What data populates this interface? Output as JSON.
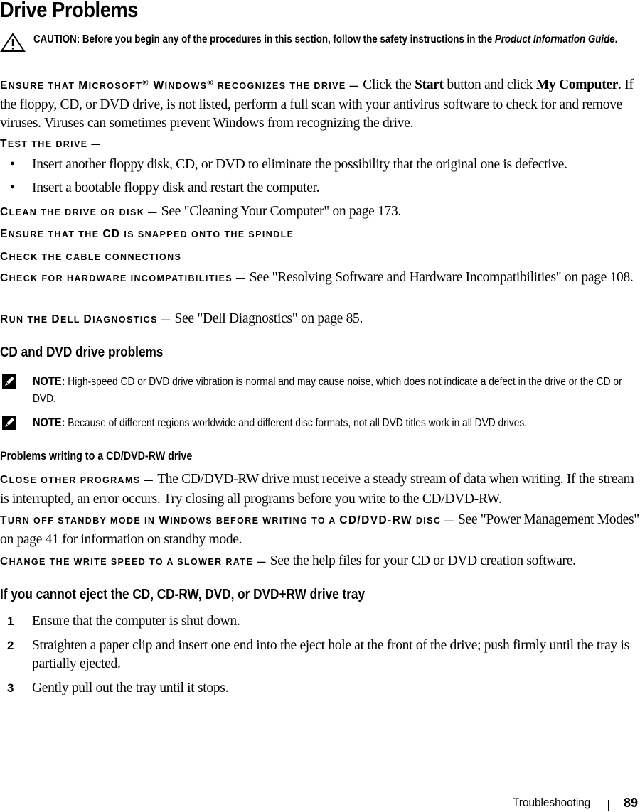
{
  "page_title": "Drive Problems",
  "caution": {
    "icon": "warning-triangle-icon",
    "label": "CAUTION:",
    "text_before": " Before you begin any of the procedures in this section, follow the safety instructions in the ",
    "guide_name": "Product Information Guide",
    "text_after": "."
  },
  "sections": {
    "ensure_windows": {
      "lead_parts": [
        "E",
        "nsure that ",
        "M",
        "icrosoft",
        "®",
        " W",
        "indows",
        "®",
        " recognizes the drive — "
      ],
      "text1": "Click the ",
      "bold1": "Start",
      "text2": " button and click ",
      "bold2": "My Computer",
      "text3": ". If the floppy, CD, or DVD drive, is not listed, perform a full scan with your antivirus software to check for and remove viruses. Viruses can sometimes prevent Windows from recognizing the drive."
    },
    "test_drive": {
      "lead": [
        "T",
        "est the drive —"
      ],
      "bullets": [
        "Insert another floppy disk, CD, or DVD to eliminate the possibility that the original one is defective.",
        "Insert a bootable floppy disk and restart the computer."
      ]
    },
    "clean_drive": {
      "lead": [
        "C",
        "lean the drive or disk — "
      ],
      "text": "See \"Cleaning Your Computer\" on page 173."
    },
    "ensure_cd": {
      "lead": [
        "E",
        "nsure that the ",
        "CD",
        " is snapped onto the spindle"
      ]
    },
    "check_cable": {
      "lead": [
        "C",
        "heck the cable connections"
      ]
    },
    "check_hardware": {
      "lead": [
        "C",
        "heck for hardware incompatibilities — "
      ],
      "text": "See \"Resolving Software and Hardware Incompatibilities\" on page 108."
    },
    "run_diagnostics": {
      "lead": [
        "R",
        "un the ",
        "D",
        "ell ",
        "D",
        "iagnostics — "
      ],
      "text": "See \"Dell Diagnostics\" on page 85."
    }
  },
  "cd_dvd": {
    "heading": "CD and DVD drive problems",
    "notes": [
      {
        "icon": "note-pencil-icon",
        "label": "NOTE:",
        "text": " High-speed CD or DVD drive vibration is normal and may cause noise, which does not indicate a defect in the drive or the CD or DVD."
      },
      {
        "icon": "note-pencil-icon",
        "label": "NOTE:",
        "text": " Because of different regions worldwide and different disc formats, not all DVD titles work in all DVD drives."
      }
    ]
  },
  "writing": {
    "heading": "Problems writing to a CD/DVD-RW drive",
    "close_programs": {
      "lead": [
        "C",
        "lose other programs — "
      ],
      "text": "The CD/DVD-RW drive must receive a steady stream of data when writing. If the stream is interrupted, an error occurs. Try closing all programs before you write to the CD/DVD-RW."
    },
    "standby": {
      "lead": [
        "T",
        "urn off standby mode in ",
        "W",
        "indows before writing to a ",
        "CD/DVD-RW",
        " disc — "
      ],
      "text": "See \"Power Management Modes\" on page 41 for information on standby mode."
    },
    "write_speed": {
      "lead": [
        "C",
        "hange the write speed to a slower rate — "
      ],
      "text": "See the help files for your CD or DVD creation software."
    }
  },
  "eject": {
    "heading": "If you cannot eject the CD, CD-RW, DVD, or DVD+RW drive tray",
    "steps": [
      {
        "num": "1",
        "text": "Ensure that the computer is shut down."
      },
      {
        "num": "2",
        "text": "Straighten a paper clip and insert one end into the eject hole at the front of the drive; push firmly until the tray is partially ejected."
      },
      {
        "num": "3",
        "text": "Gently pull out the tray until it stops."
      }
    ]
  },
  "footer": {
    "section": "Troubleshooting",
    "page_number": "89"
  }
}
